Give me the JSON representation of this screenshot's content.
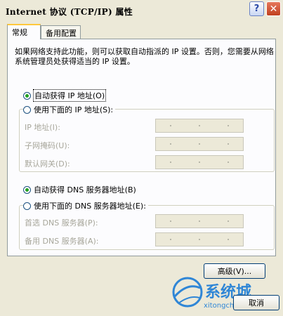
{
  "window": {
    "title": "Internet 协议 (TCP/IP) 属性"
  },
  "titlebar_buttons": {
    "help": "?",
    "close": "✕"
  },
  "tabs": [
    {
      "label": "常规"
    },
    {
      "label": "备用配置"
    }
  ],
  "description": "如果网络支持此功能，则可以获取自动指派的 IP 设置。否则，您需要从网络系统管理员处获得适当的 IP 设置。",
  "ip_section": {
    "auto_option": "自动获得 IP 地址(O)",
    "manual_option": "使用下面的 IP 地址(S):",
    "fields": [
      {
        "label": "IP 地址(I):"
      },
      {
        "label": "子网掩码(U):"
      },
      {
        "label": "默认网关(D):"
      }
    ]
  },
  "dns_section": {
    "auto_option": "自动获得 DNS 服务器地址(B)",
    "manual_option": "使用下面的 DNS 服务器地址(E):",
    "fields": [
      {
        "label": "首选 DNS 服务器(P):"
      },
      {
        "label": "备用 DNS 服务器(A):"
      }
    ]
  },
  "buttons": {
    "advanced": "高级(V)...",
    "cancel": "取消"
  },
  "watermark": {
    "brand": "系统城",
    "url": "xitongcheng.com"
  },
  "colors": {
    "window_bg": "#ece9d8",
    "panel_bg": "#fcfcfe",
    "radio_checked": "#21a121",
    "close_button": "#c0401f",
    "watermark_blue": "#2f86d6"
  }
}
